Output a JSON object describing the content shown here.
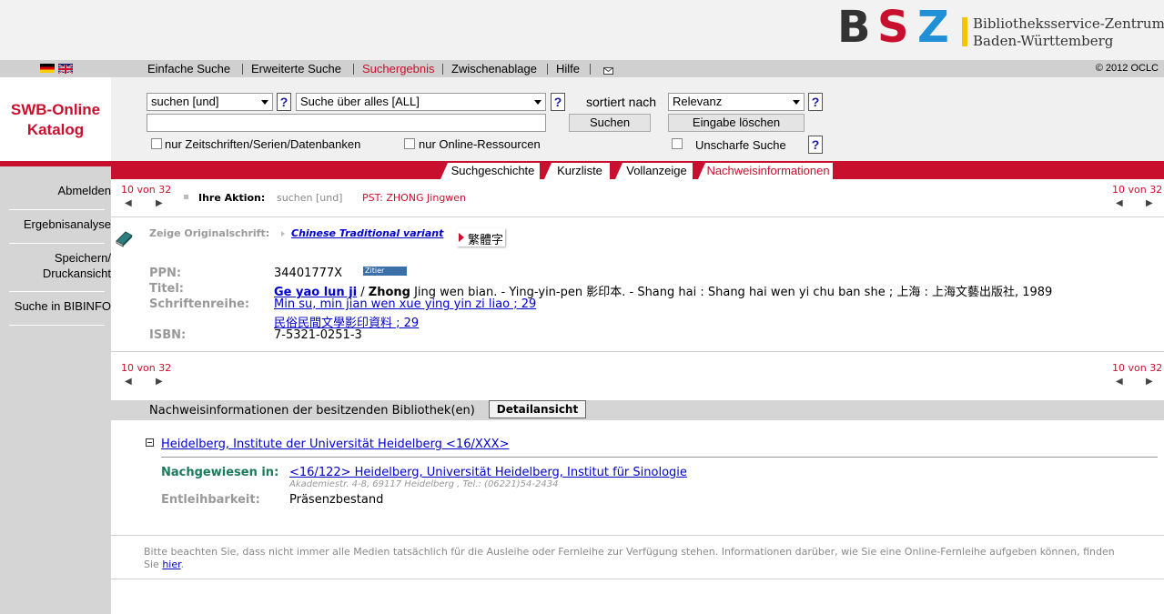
{
  "header": {
    "logo_text": "BSZ",
    "logo_line1": "Bibliotheksservice-Zentrum",
    "logo_line2": "Baden-Württemberg",
    "colors": {
      "brand_red": "#c8102e",
      "logo_yellow": "#f5c400",
      "logo_blue": "#1f8fd6",
      "logo_dark": "#333333"
    }
  },
  "nav": {
    "items": [
      "Einfache Suche",
      "Erweiterte Suche",
      "Suchergebnis",
      "Zwischenablage",
      "Hilfe"
    ],
    "active": "Suchergebnis",
    "mail_icon": "mail-icon",
    "copyright": "© 2012 OCLC"
  },
  "sidebar": {
    "title_line1": "SWB-Online",
    "title_line2": "Katalog",
    "items": [
      "Abmelden",
      "Ergebnisanalyse",
      "Speichern/",
      "Druckansicht",
      "Suche in BIBINFO"
    ]
  },
  "search": {
    "operator_select": "suchen [und]",
    "field_select": "Suche über alles [ALL]",
    "sort_label": "sortiert nach",
    "sort_select": "Relevanz",
    "query_value": "",
    "search_button": "Suchen",
    "clear_button": "Eingabe löschen",
    "cb_journals": "nur Zeitschriften/Serien/Datenbanken",
    "cb_online": "nur Online-Ressourcen",
    "cb_fuzzy": "Unscharfe Suche",
    "help": "?"
  },
  "tabs": [
    "Suchgeschichte",
    "Kurzliste",
    "Vollanzeige",
    "Nachweisinformationen"
  ],
  "result": {
    "pager": "10 von 32",
    "action_label": "Ihre Aktion:",
    "action_value": "suchen [und]",
    "action_query": "PST: ZHONG Jingwen",
    "orig_script_label": "Zeige Originalschrift:",
    "orig_script_link": "Chinese Traditional variant",
    "orig_script_chars": "繁體字",
    "cite_badge": "Zitier",
    "fields": {
      "ppn_label": "PPN:",
      "ppn": "34401777X",
      "title_label": "Titel:",
      "title_link": "Ge yao lun ji",
      "title_sep": " / ",
      "title_author": "Zhong",
      "title_rest": " Jing wen bian. - Ying-yin-pen 影印本. - Shang hai : Shang hai wen yi chu ban she ; 上海 : 上海文藝出版社, 1989",
      "series_label": "Schriftenreihe:",
      "series_1": "Min su, min jian wen xue ying yin zi liao ; 29",
      "series_2": "民俗民間文學影印資料 ; 29",
      "isbn_label": "ISBN:",
      "isbn": "7-5321-0251-3"
    }
  },
  "holdings": {
    "bar_title": "Nachweisinformationen der besitzenden Bibliothek(en)",
    "detail_button": "Detailansicht",
    "collapse_icon": "minus-icon",
    "library": "Heidelberg, Institute der Universität Heidelberg <16/XXX>",
    "proven_label": "Nachgewiesen in:",
    "proven_link": "<16/122> Heidelberg, Universität Heidelberg, Institut für Sinologie",
    "address": "Akademiestr. 4-8, 69117 Heidelberg , Tel.: (06221)54-2434",
    "lending_label": "Entleihbarkeit:",
    "lending_value": "Präsenzbestand"
  },
  "footer": {
    "note": "Bitte beachten Sie, dass nicht immer alle Medien tatsächlich für die Ausleihe oder Fernleihe zur Verfügung stehen. Informationen darüber, wie Sie eine Online-Fernleihe aufgeben können, finden",
    "note2_prefix": "Sie ",
    "note2_link": "hier",
    "note2_suffix": "."
  }
}
